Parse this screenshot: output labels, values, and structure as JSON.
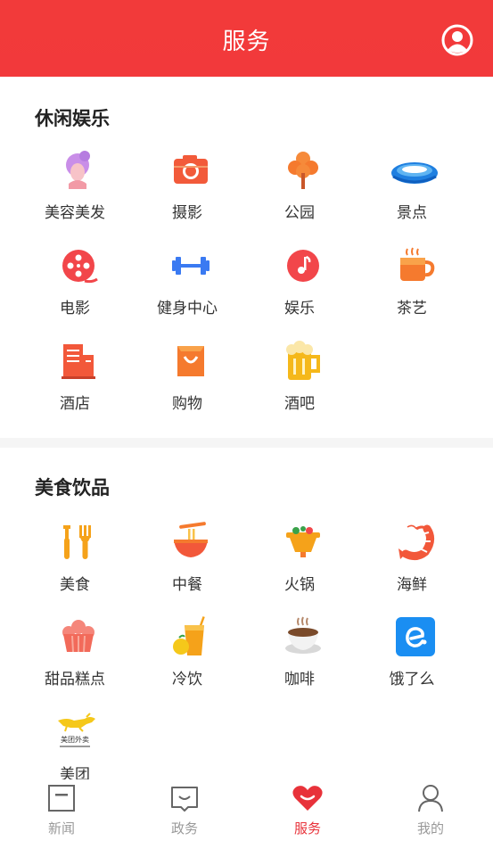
{
  "header": {
    "title": "服务",
    "user_icon": "user-avatar-icon"
  },
  "sections": [
    {
      "title": "休闲娱乐",
      "items": [
        {
          "label": "美容美发",
          "icon": "beauty-hair-icon"
        },
        {
          "label": "摄影",
          "icon": "camera-icon"
        },
        {
          "label": "公园",
          "icon": "park-tree-icon"
        },
        {
          "label": "景点",
          "icon": "scenic-spot-icon"
        },
        {
          "label": "电影",
          "icon": "film-reel-icon"
        },
        {
          "label": "健身中心",
          "icon": "dumbbell-icon"
        },
        {
          "label": "娱乐",
          "icon": "music-note-icon"
        },
        {
          "label": "茶艺",
          "icon": "tea-cup-icon"
        },
        {
          "label": "酒店",
          "icon": "hotel-building-icon"
        },
        {
          "label": "购物",
          "icon": "shopping-bag-icon"
        },
        {
          "label": "酒吧",
          "icon": "beer-mug-icon"
        }
      ]
    },
    {
      "title": "美食饮品",
      "items": [
        {
          "label": "美食",
          "icon": "fork-knife-icon"
        },
        {
          "label": "中餐",
          "icon": "noodle-bowl-icon"
        },
        {
          "label": "火锅",
          "icon": "hotpot-icon"
        },
        {
          "label": "海鲜",
          "icon": "shrimp-icon"
        },
        {
          "label": "甜品糕点",
          "icon": "cupcake-icon"
        },
        {
          "label": "冷饮",
          "icon": "cold-drink-icon"
        },
        {
          "label": "咖啡",
          "icon": "coffee-cup-icon"
        },
        {
          "label": "饿了么",
          "icon": "eleme-logo-icon"
        },
        {
          "label": "美团",
          "icon": "meituan-waimai-logo-icon",
          "logo_text": "美团外卖"
        }
      ]
    }
  ],
  "tabbar": [
    {
      "label": "新闻",
      "icon": "news-icon",
      "active": false
    },
    {
      "label": "政务",
      "icon": "government-icon",
      "active": false
    },
    {
      "label": "服务",
      "icon": "heart-smile-icon",
      "active": true
    },
    {
      "label": "我的",
      "icon": "profile-icon",
      "active": false
    }
  ],
  "colors": {
    "header": "#f2393b",
    "active_tab": "#e8323a",
    "text": "#333333"
  }
}
